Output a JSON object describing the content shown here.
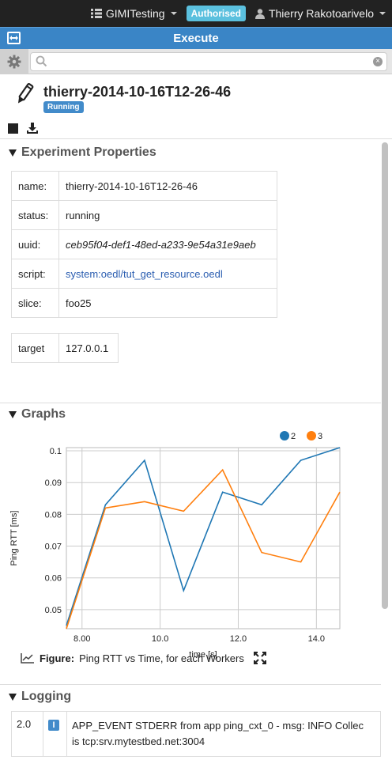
{
  "navbar": {
    "project": "GIMITesting",
    "auth_badge": "Authorised",
    "user": "Thierry Rakotoarivelo"
  },
  "panel": {
    "title": "Execute"
  },
  "search": {
    "value": "",
    "placeholder": ""
  },
  "experiment": {
    "name": "thierry-2014-10-16T12-26-46",
    "status_badge": "Running"
  },
  "sections": {
    "properties": "Experiment Properties",
    "graphs": "Graphs",
    "logging": "Logging"
  },
  "properties": [
    {
      "key": "name:",
      "value": "thierry-2014-10-16T12-26-46"
    },
    {
      "key": "status:",
      "value": "running"
    },
    {
      "key": "uuid:",
      "value": "ceb95f04-def1-48ed-a233-9e54a31e9aeb"
    },
    {
      "key": "script:",
      "value": "system:oedl/tut_get_resource.oedl"
    },
    {
      "key": "slice:",
      "value": "foo25"
    }
  ],
  "target": {
    "key": "target",
    "value": "127.0.0.1"
  },
  "chart_data": {
    "type": "line",
    "title": "",
    "xlabel": "time [s]",
    "ylabel": "Ping RTT [ms]",
    "xlim": [
      7.6,
      14.6
    ],
    "ylim": [
      0.044,
      0.101
    ],
    "xticks": [
      "8.00",
      "10.0",
      "12.0",
      "14.0"
    ],
    "yticks": [
      "0.05",
      "0.06",
      "0.07",
      "0.08",
      "0.09",
      "0.1"
    ],
    "grid": true,
    "legend_position": "top-right",
    "series": [
      {
        "name": "2",
        "color": "#1f77b4",
        "x": [
          7.6,
          8.6,
          9.6,
          10.6,
          11.6,
          12.6,
          13.6,
          14.6
        ],
        "y": [
          0.045,
          0.083,
          0.097,
          0.056,
          0.087,
          0.083,
          0.097,
          0.101
        ]
      },
      {
        "name": "3",
        "color": "#ff7f0e",
        "x": [
          7.6,
          8.6,
          9.6,
          10.6,
          11.6,
          12.6,
          13.6,
          14.6
        ],
        "y": [
          0.044,
          0.082,
          0.084,
          0.081,
          0.094,
          0.068,
          0.065,
          0.087
        ]
      }
    ]
  },
  "figure": {
    "label": "Figure:",
    "caption": "Ping RTT vs Time, for each Workers"
  },
  "logging": [
    {
      "time": "2.0",
      "level": "I",
      "message_line1": "APP_EVENT STDERR from app ping_cxt_0 - msg: INFO Collec",
      "message_line2": "is tcp:srv.mytestbed.net:3004"
    }
  ]
}
